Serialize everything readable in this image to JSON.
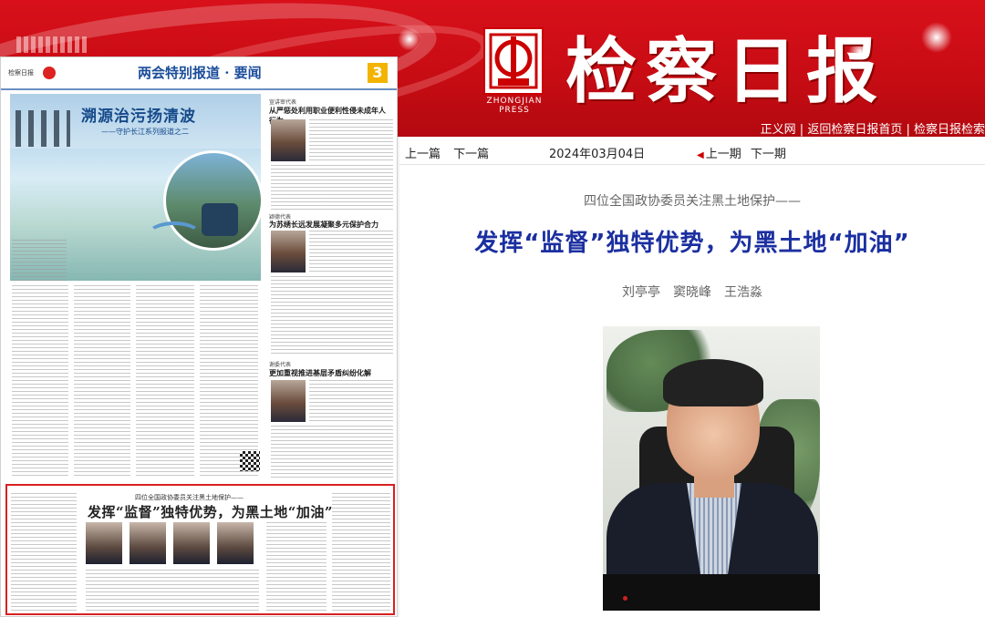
{
  "header": {
    "brand_title": "检察日报",
    "logo_caption": "ZHONGJIAN PRESS",
    "nav_links": [
      "正义网",
      "返回检察日报首页",
      "检察日报检索"
    ]
  },
  "paper": {
    "section": "两会特别报道 · 要闻",
    "page_no": "3",
    "masthead_left": "检察日报",
    "hero_title": "溯源治污扬清波",
    "hero_subtitle": "——守护长江系列报道之二",
    "sidebar": [
      {
        "tag": "宣讲审代表",
        "title": "从严惩处利用职业便利性侵未成年人行为"
      },
      {
        "tag": "颖德代表",
        "title": "为苏绣长远发展凝聚多元保护合力"
      },
      {
        "tag": "谢委代表",
        "title": "更加重视推进基层矛盾纠纷化解"
      }
    ],
    "feature_kicker": "四位全国政协委员关注黑土地保护——",
    "feature_headline": "发挥“监督”独特优势，为黑土地“加油”"
  },
  "article": {
    "pager": {
      "prev": "上一篇",
      "next": "下一篇"
    },
    "date": "2024年03月04日",
    "issue_nav": {
      "prev": "上一期",
      "next": "下一期"
    },
    "kicker": "四位全国政协委员关注黑土地保护——",
    "title": "发挥“监督”独特优势，为黑土地“加油”",
    "authors": "刘亭亭　窦晓峰　王浩淼"
  },
  "colors": {
    "brand_red": "#c80c14",
    "title_blue": "#1b2fa0",
    "highlight_border": "#d82020"
  }
}
